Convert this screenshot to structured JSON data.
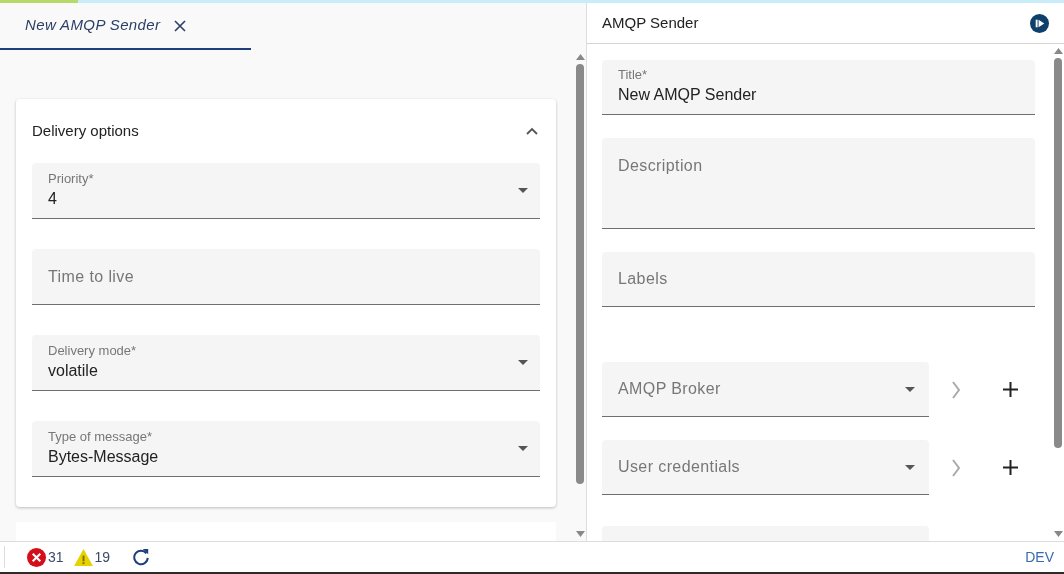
{
  "progress": {
    "level": 0.073
  },
  "tabs": [
    {
      "label": "New AMQP Sender",
      "selected": true
    }
  ],
  "card": {
    "title": "Delivery options",
    "expanded": true,
    "fields": [
      {
        "kind": "select",
        "label": "Priority*",
        "value": "4"
      },
      {
        "kind": "text",
        "label": "Time to live"
      },
      {
        "kind": "select",
        "label": "Delivery mode*",
        "value": "volatile"
      },
      {
        "kind": "select",
        "label": "Type of message*",
        "value": "Bytes-Message"
      }
    ]
  },
  "panel": {
    "title": "AMQP Sender",
    "fields": [
      {
        "kind": "text",
        "label": "Title*",
        "value": "New AMQP Sender"
      },
      {
        "kind": "textarea",
        "label": "Description"
      },
      {
        "kind": "text",
        "label": "Labels"
      },
      {
        "kind": "reference",
        "label": "AMQP Broker"
      },
      {
        "kind": "reference",
        "label": "User credentials"
      },
      {
        "kind": "blank"
      }
    ]
  },
  "status_bar": {
    "errors": "31",
    "warnings": "19",
    "environment": "DEV"
  }
}
